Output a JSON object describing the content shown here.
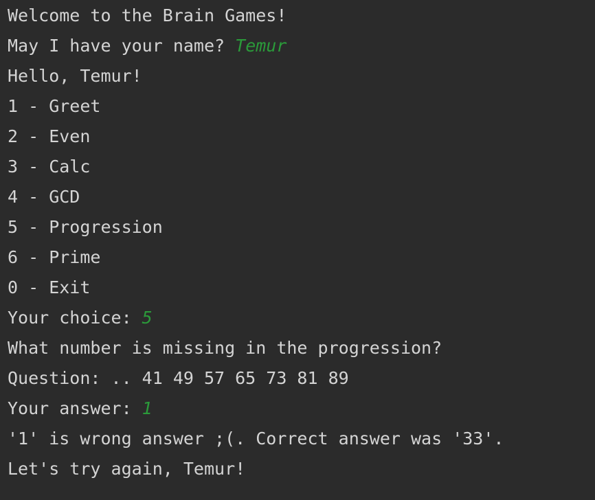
{
  "colors": {
    "background": "#2b2b2b",
    "text": "#d4d4d4",
    "user_input": "#2b9a3a"
  },
  "console": {
    "lines": [
      {
        "text": "Welcome to the Brain Games!",
        "input": ""
      },
      {
        "text": "May I have your name? ",
        "input": "Temur"
      },
      {
        "text": "Hello, Temur!",
        "input": ""
      },
      {
        "text": "1 - Greet",
        "input": ""
      },
      {
        "text": "2 - Even",
        "input": ""
      },
      {
        "text": "3 - Calc",
        "input": ""
      },
      {
        "text": "4 - GCD",
        "input": ""
      },
      {
        "text": "5 - Progression",
        "input": ""
      },
      {
        "text": "6 - Prime",
        "input": ""
      },
      {
        "text": "0 - Exit",
        "input": ""
      },
      {
        "text": "Your choice: ",
        "input": "5"
      },
      {
        "text": "What number is missing in the progression?",
        "input": ""
      },
      {
        "text": "Question: .. 41 49 57 65 73 81 89",
        "input": ""
      },
      {
        "text": "Your answer: ",
        "input": "1"
      },
      {
        "text": "'1' is wrong answer ;(. Correct answer was '33'.",
        "input": ""
      },
      {
        "text": "Let's try again, Temur!",
        "input": ""
      }
    ]
  }
}
